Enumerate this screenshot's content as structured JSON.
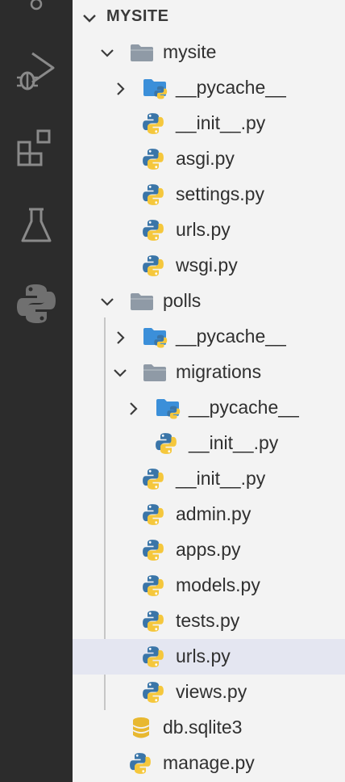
{
  "activity_bar": {
    "items": [
      "search-icon",
      "run-debug-icon",
      "extensions-icon",
      "testing-icon",
      "python-icon"
    ]
  },
  "explorer": {
    "section_title": "MYSITE",
    "items": [
      {
        "label": "mysite",
        "type": "folder",
        "depth": 1,
        "expanded": true
      },
      {
        "label": "__pycache__",
        "type": "pycache-folder",
        "depth": 2,
        "expanded": false
      },
      {
        "label": "__init__.py",
        "type": "python-file",
        "depth": 2
      },
      {
        "label": "asgi.py",
        "type": "python-file",
        "depth": 2
      },
      {
        "label": "settings.py",
        "type": "python-file",
        "depth": 2
      },
      {
        "label": "urls.py",
        "type": "python-file",
        "depth": 2
      },
      {
        "label": "wsgi.py",
        "type": "python-file",
        "depth": 2
      },
      {
        "label": "polls",
        "type": "folder",
        "depth": 1,
        "expanded": true
      },
      {
        "label": "__pycache__",
        "type": "pycache-folder",
        "depth": 2,
        "expanded": false
      },
      {
        "label": "migrations",
        "type": "folder",
        "depth": 2,
        "expanded": true
      },
      {
        "label": "__pycache__",
        "type": "pycache-folder",
        "depth": 3,
        "expanded": false
      },
      {
        "label": "__init__.py",
        "type": "python-file",
        "depth": 3
      },
      {
        "label": "__init__.py",
        "type": "python-file",
        "depth": 2
      },
      {
        "label": "admin.py",
        "type": "python-file",
        "depth": 2
      },
      {
        "label": "apps.py",
        "type": "python-file",
        "depth": 2
      },
      {
        "label": "models.py",
        "type": "python-file",
        "depth": 2
      },
      {
        "label": "tests.py",
        "type": "python-file",
        "depth": 2
      },
      {
        "label": "urls.py",
        "type": "python-file",
        "depth": 2,
        "selected": true
      },
      {
        "label": "views.py",
        "type": "python-file",
        "depth": 2
      },
      {
        "label": "db.sqlite3",
        "type": "database-file",
        "depth": 1
      },
      {
        "label": "manage.py",
        "type": "python-file",
        "depth": 1
      }
    ]
  },
  "colors": {
    "activity_bar_bg": "#2c2c2c",
    "sidebar_bg": "#f3f3f3",
    "selected_row_bg": "#e4e6f1",
    "python_blue": "#3a75a8",
    "python_yellow": "#f5c73c",
    "folder_gray": "#8f9aa6",
    "folder_blue": "#3b8fd9",
    "database_yellow": "#e8b830"
  }
}
